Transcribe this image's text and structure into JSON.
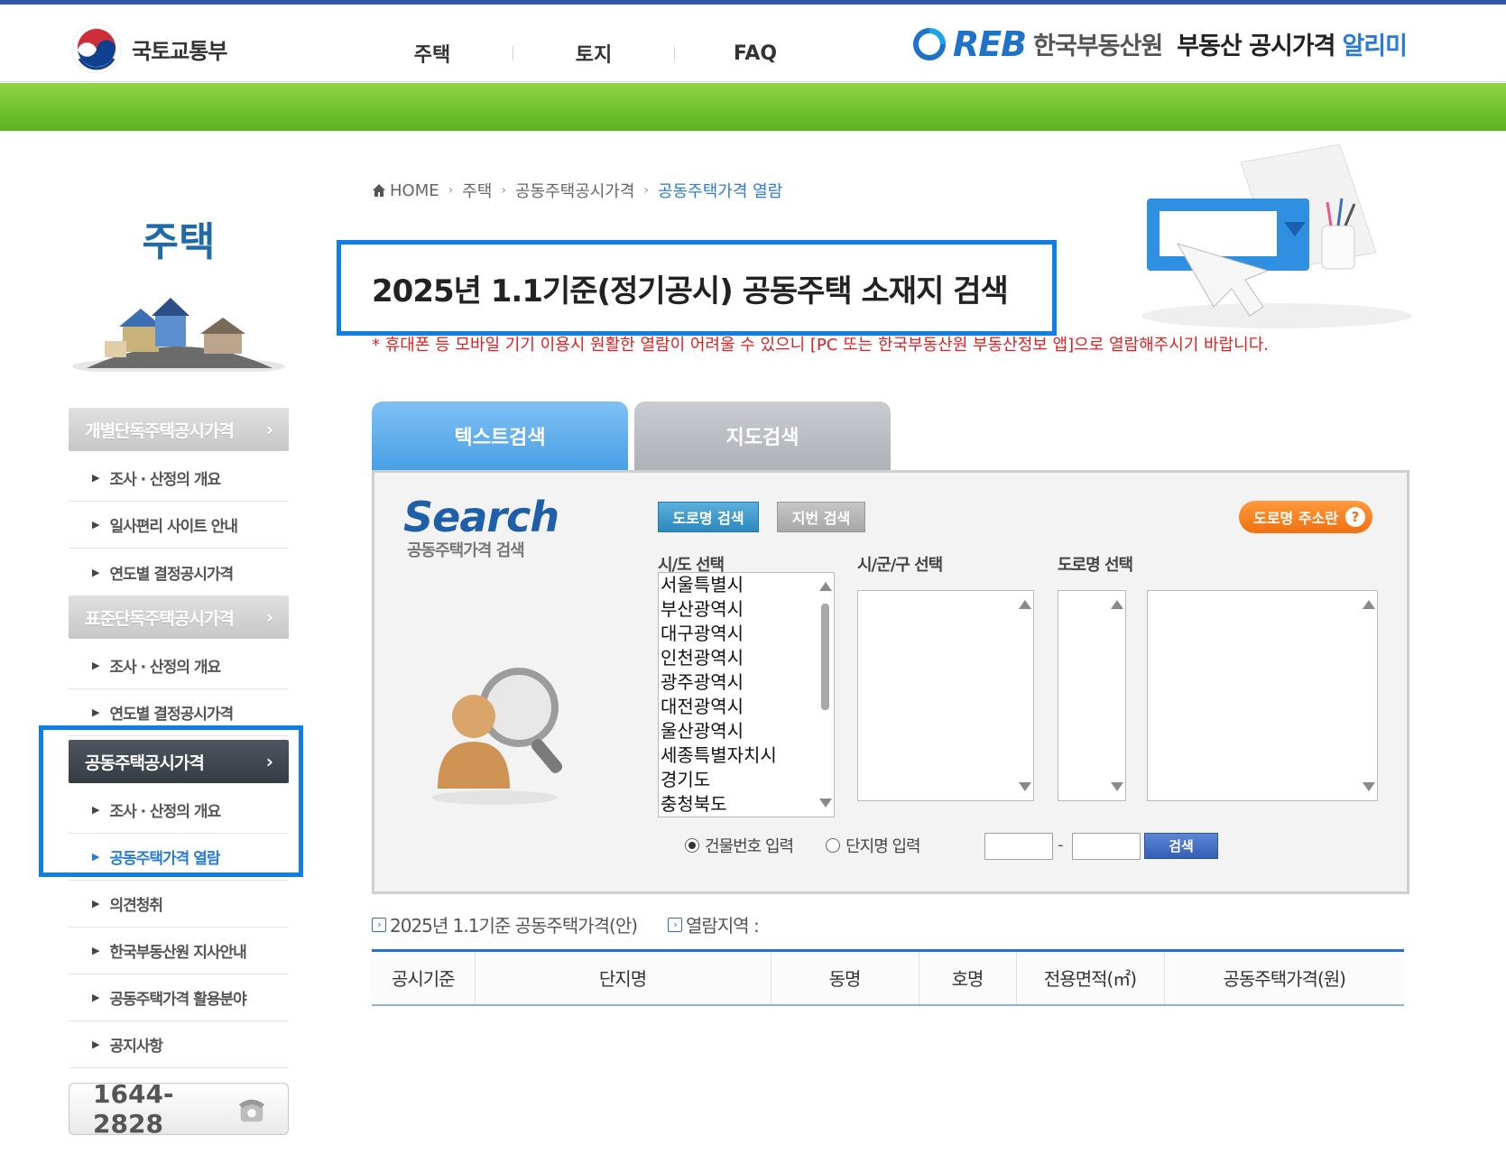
{
  "header": {
    "ministry_name": "국토교통부",
    "nav": [
      {
        "label": "주택"
      },
      {
        "label": "토지"
      },
      {
        "label": "FAQ"
      }
    ],
    "reb_logo": "REB",
    "reb_org": "한국부동산원",
    "site_title": "부동산 공시가격",
    "site_title_accent": "알리미"
  },
  "sidebar": {
    "title": "주택",
    "groups": [
      {
        "label": "개별단독주택공시가격",
        "active": false,
        "items": [
          {
            "label": "조사 · 산정의 개요"
          },
          {
            "label": "일사편리 사이트 안내"
          },
          {
            "label": "연도별 결정공시가격"
          }
        ]
      },
      {
        "label": "표준단독주택공시가격",
        "active": false,
        "items": [
          {
            "label": "조사 · 산정의 개요"
          },
          {
            "label": "연도별 결정공시가격"
          }
        ]
      },
      {
        "label": "공동주택공시가격",
        "active": true,
        "items": [
          {
            "label": "조사 · 산정의 개요"
          },
          {
            "label": "공동주택가격 열람",
            "current": true
          },
          {
            "label": "의견청취"
          },
          {
            "label": "한국부동산원 지사안내"
          },
          {
            "label": "공동주택가격 활용분야"
          },
          {
            "label": "공지사항"
          }
        ]
      }
    ],
    "phone": "1644-2828"
  },
  "breadcrumb": {
    "home": "HOME",
    "items": [
      "주택",
      "공동주택공시가격"
    ],
    "current": "공동주택가격 열람"
  },
  "page": {
    "title": "2025년 1.1기준(정기공시) 공동주택 소재지 검색",
    "notice": "* 휴대폰 등 모바일 기기 이용시 원활한 열람이 어려울 수 있으니 [PC 또는 한국부동산원 부동산정보 앱]으로 열람해주시기 바랍니다."
  },
  "tabs": {
    "text": "텍스트검색",
    "map": "지도검색"
  },
  "search": {
    "brand": "Search",
    "brand_sub": "공동주택가격 검색",
    "road_search_btn": "도로명 검색",
    "jibun_search_btn": "지번 검색",
    "road_addr_btn": "도로명 주소란",
    "labels": {
      "sido": "시/도 선택",
      "sigungu": "시/군/구 선택",
      "road": "도로명 선택"
    },
    "sido_options": [
      "서울특별시",
      "부산광역시",
      "대구광역시",
      "인천광역시",
      "광주광역시",
      "대전광역시",
      "울산광역시",
      "세종특별자치시",
      "경기도",
      "충청북도"
    ],
    "radio_building": "건물번호 입력",
    "radio_complex": "단지명 입력",
    "radio_selected": "building",
    "search_btn": "검색"
  },
  "results": {
    "base_label": "2025년 1.1기준 공동주택가격(안)",
    "region_label": "열람지역 :",
    "columns": [
      "공시기준",
      "단지명",
      "동명",
      "호명",
      "전용면적(㎡)",
      "공동주택가격(원)"
    ]
  },
  "colors": {
    "primary_blue": "#2a7bd6",
    "highlight_blue": "#0e7fe8",
    "green_bar": "#6cc12c",
    "notice_red": "#e02020",
    "orange": "#f07010"
  }
}
